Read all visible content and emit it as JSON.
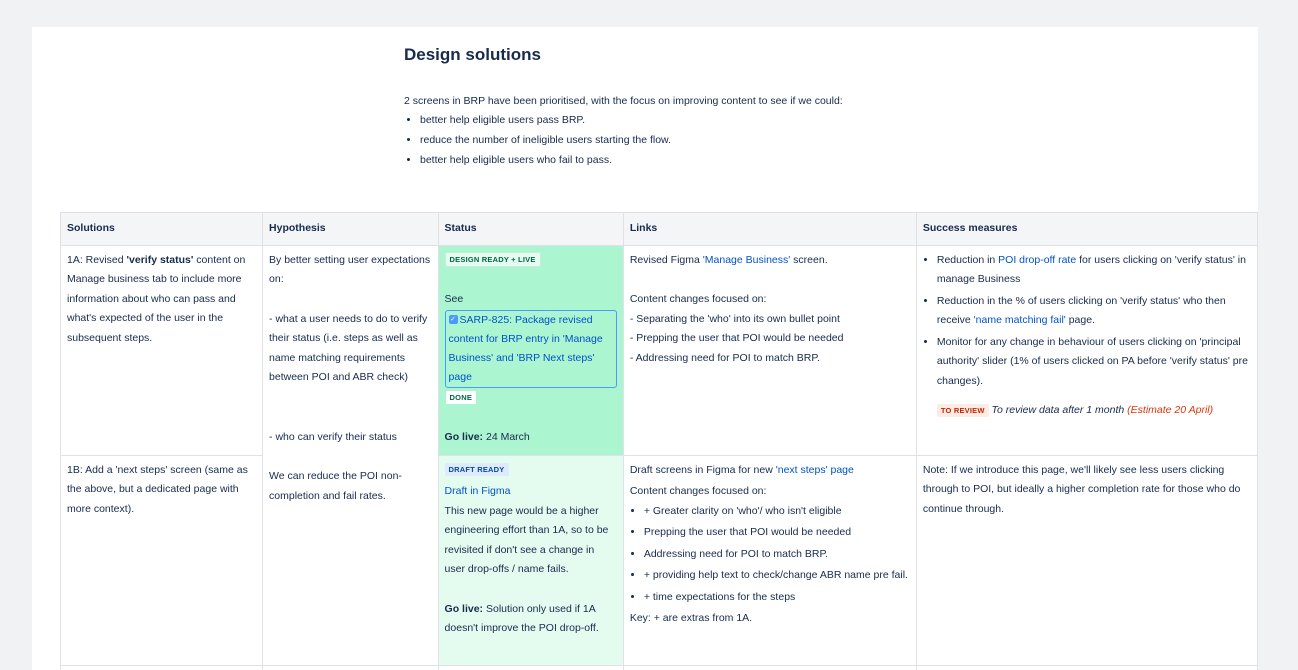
{
  "title": "Design solutions",
  "intro": {
    "text": "2 screens in BRP have been prioritised, with the focus on improving content to see if we could:",
    "bullets": [
      "better help eligible users pass BRP.",
      "reduce the number of ineligible users starting the flow.",
      "better help eligible users who fail to pass."
    ]
  },
  "table": {
    "headers": [
      "Solutions",
      "Hypothesis",
      "Status",
      "Links",
      "Success measures"
    ],
    "rows": [
      {
        "solution": {
          "pre": "1A: Revised ",
          "bold": "'verify status'",
          "post": " content on Manage business tab to include more information about who can pass and what's expected of the user in the subsequent steps."
        },
        "hypothesis": {
          "p1": "By better setting user expectations on:",
          "p2": "- what a user needs to do to verify their status (i.e. steps as well as name matching requirements between POI and ABR check)",
          "p3": "- who can verify their status",
          "p4": "We can reduce the POI non-completion and fail rates."
        },
        "status": {
          "lozenge": "DESIGN READY + LIVE",
          "see": "See",
          "jira": "SARP-825: Package revised content for BRP entry in 'Manage Business' and 'BRP Next steps' page",
          "done": "DONE",
          "golive_label": "Go live:",
          "golive_value": " 24 March"
        },
        "links": {
          "pre": "Revised Figma ",
          "link": "'Manage Business'",
          "post": " screen.",
          "focus": "Content changes focused on:",
          "items": [
            "- Separating the 'who' into its own bullet point",
            "- Prepping the user that POI would be needed",
            "- Addressing need for POI to match BRP."
          ]
        },
        "success": {
          "b1_pre": "Reduction in ",
          "b1_link": "POI drop-off rate",
          "b1_post": " for users clicking on 'verify status' in manage Business",
          "b2_pre": "Reduction in the % of users clicking on 'verify status' who then receive ",
          "b2_link": "'name matching fail'",
          "b2_post": " page.",
          "b3": "Monitor for any change in behaviour of users clicking on 'principal authority' slider (1% of users clicked on PA before 'verify status' pre changes).",
          "review_lozenge": "TO REVIEW",
          "review_text": " To review data after 1 month ",
          "review_estimate": "(Estimate 20 April)"
        }
      },
      {
        "solution": {
          "text": "1B: Add a 'next steps' screen (same as the above, but a dedicated page with more context)."
        },
        "status": {
          "lozenge": "DRAFT READY",
          "link": "Draft in Figma",
          "desc": "This new page would be a higher engineering effort than 1A, so to be revisited if don't see a change in user drop-offs / name fails.",
          "golive_label": "Go live:",
          "golive_value": " Solution only used if 1A doesn't improve the POI drop-off."
        },
        "links": {
          "pre": "Draft screens in Figma for new ",
          "link": "'next steps' page",
          "focus": "Content changes focused on:",
          "items": [
            "+ Greater clarity on 'who'/ who isn't eligible",
            "Prepping the user that POI would be needed",
            "Addressing need for POI to match BRP.",
            "+ providing help text to check/change ABR name pre fail.",
            "+ time expectations for the steps"
          ],
          "key": "Key: + are extras from 1A."
        },
        "success": {
          "text": "Note: If we introduce this page, we'll likely see less users clicking through to POI, but ideally a higher completion rate for those who do continue through."
        }
      }
    ]
  }
}
